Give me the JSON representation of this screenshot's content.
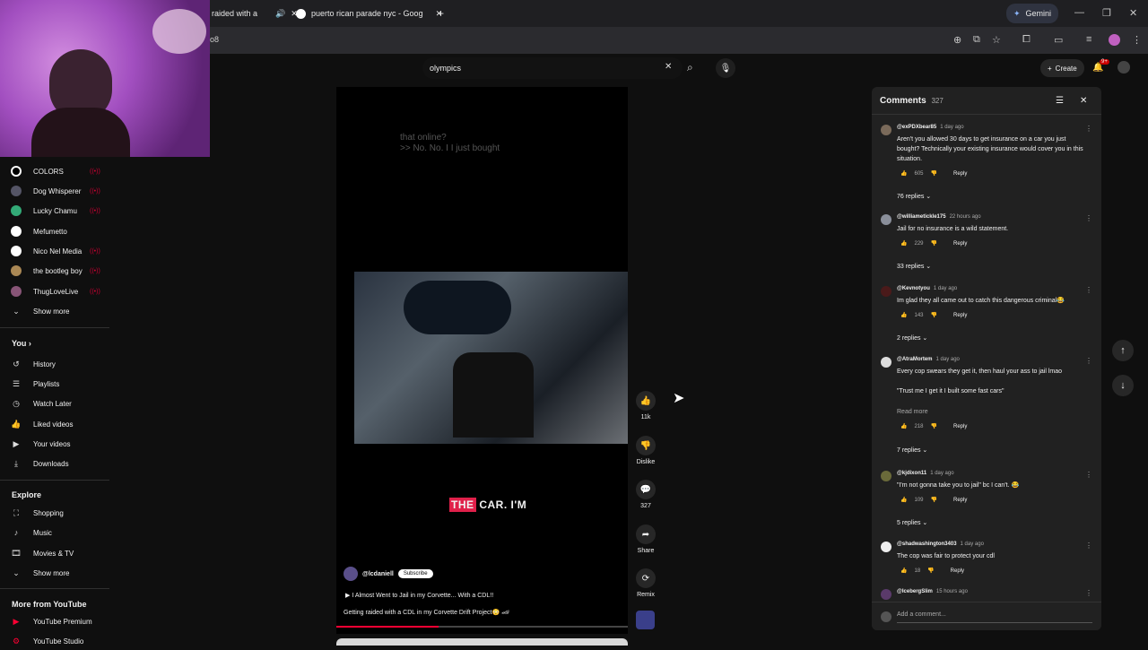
{
  "browser": {
    "tabs": [
      {
        "label": "raided with a"
      },
      {
        "label": "puerto rican parade nyc - Goog"
      }
    ],
    "new_tab": "+",
    "gemini": "Gemini",
    "address_fragment": "o8"
  },
  "search": {
    "value": "olympics"
  },
  "header": {
    "create": "Create",
    "notifications": "9+"
  },
  "sidebar": {
    "subscriptions": [
      {
        "label": "COLORS"
      },
      {
        "label": "Dog Whisperer"
      },
      {
        "label": "Lucky Chamu"
      },
      {
        "label": "Mefumetto"
      },
      {
        "label": "Nico Nel Media"
      },
      {
        "label": "the bootleg boy"
      },
      {
        "label": "ThugLoveLive"
      }
    ],
    "show_more": "Show more",
    "you": "You",
    "you_items": [
      {
        "label": "History"
      },
      {
        "label": "Playlists"
      },
      {
        "label": "Watch Later"
      },
      {
        "label": "Liked videos"
      },
      {
        "label": "Your videos"
      },
      {
        "label": "Downloads"
      }
    ],
    "explore": "Explore",
    "explore_items": [
      {
        "label": "Shopping"
      },
      {
        "label": "Music"
      },
      {
        "label": "Movies & TV"
      }
    ],
    "show_more2": "Show more",
    "more_from_youtube": "More from YouTube",
    "more_items": [
      {
        "label": "YouTube Premium"
      },
      {
        "label": "YouTube Studio"
      }
    ]
  },
  "video": {
    "subtitle_line1": "that online?",
    "subtitle_line2": ">> No. No. I I just bought",
    "caption_highlight": "THE",
    "caption_rest": "CAR. I'M",
    "channel": "@lcdaniell",
    "subscribe": "Subscribe",
    "title": "I Almost Went to Jail in my Corvette... With a CDL!!",
    "description": "Getting raided with a CDL in my Corvette Drift Project😳 🏎",
    "progress": 0.35
  },
  "actions": {
    "likes": "11k",
    "dislike": "Dislike",
    "comments": "327",
    "share": "Share",
    "remix": "Remix"
  },
  "comments_panel": {
    "title": "Comments",
    "count": "327",
    "add_placeholder": "Add a comment...",
    "items": [
      {
        "user": "@exPDXbear85",
        "time": "1 day ago",
        "text": "Aren't you allowed 30 days to get insurance on a car you just bought? Technically your existing insurance would cover you in this situation.",
        "likes": "605",
        "reply": "Reply",
        "replies": "76 replies"
      },
      {
        "user": "@williametickle175",
        "time": "22 hours ago",
        "text": "Jail for no insurance is a wild statement.",
        "likes": "229",
        "reply": "Reply",
        "replies": "33 replies"
      },
      {
        "user": "@Kevnotyou",
        "time": "1 day ago",
        "text": "Im glad they all came out to catch this dangerous criminal😂",
        "likes": "143",
        "reply": "Reply",
        "replies": "2 replies"
      },
      {
        "user": "@AtraMortem",
        "time": "1 day ago",
        "text": "Every cop swears they get it, then haul your ass to jail lmao",
        "text2": "\"Trust me I get it I built some fast cars\"",
        "read_more": "Read more",
        "likes": "218",
        "reply": "Reply",
        "replies": "7 replies"
      },
      {
        "user": "@kjdixon11",
        "time": "1 day ago",
        "text": "\"I'm not gonna take you to jail\" bc I can't. 😂",
        "likes": "109",
        "reply": "Reply",
        "replies": "5 replies"
      },
      {
        "user": "@shadwashington3403",
        "time": "1 day ago",
        "text": "The cop was fair to protect your cdl",
        "likes": "18",
        "reply": "Reply"
      },
      {
        "user": "@IcebergSlim",
        "time": "15 hours ago"
      }
    ]
  },
  "colors": {
    "accent": "#ff0033",
    "bg": "#0f0f0f",
    "panel": "#212121"
  }
}
